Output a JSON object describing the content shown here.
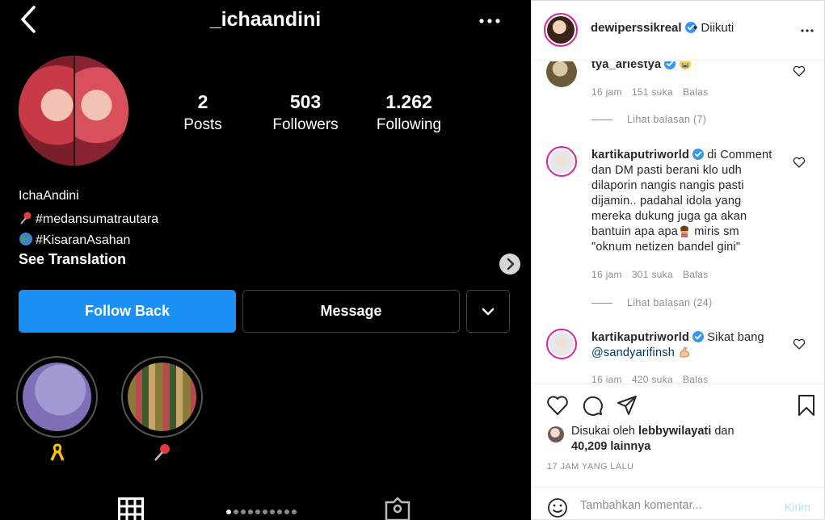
{
  "screenshot_profile": {
    "username": "_ichaandini",
    "stats": [
      {
        "value": "2",
        "label": "Posts"
      },
      {
        "value": "503",
        "label": "Followers"
      },
      {
        "value": "1.262",
        "label": "Following"
      }
    ],
    "bio_name": "IchaAndini",
    "bio_lines": [
      {
        "emoji": "pushpin-emoji",
        "text": "#medansumatrautara"
      },
      {
        "emoji": "globe-emoji",
        "text": "#KisaranAsahan"
      }
    ],
    "see_translation": "See Translation",
    "follow_back_label": "Follow Back",
    "message_label": "Message",
    "highlights": [
      {
        "emoji": "yellow-ribbon-emoji"
      },
      {
        "emoji": "pushpin-emoji"
      }
    ],
    "carousel_dots": 10,
    "carousel_active": 0,
    "colors": {
      "follow_button": "#1a8ff5",
      "background": "#000000"
    }
  },
  "post": {
    "header": {
      "username": "dewiperssikreal",
      "verified": true,
      "follow_status": "• Diikuti"
    },
    "comments": [
      {
        "username": "tya_ariestya",
        "verified": true,
        "text": "",
        "emoji": "crying-face-emoji",
        "meta": {
          "time": "16 jam",
          "likes": "151 suka",
          "reply": "Balas"
        },
        "view_replies": "Lihat balasan (7)"
      },
      {
        "username": "kartikaputriworld",
        "verified": true,
        "text": "di Comment dan DM pasti berani klo udh dilaporin nangis nangis pasti dijamin.. padahal idola yang mereka dukung juga ga akan bantuin apa apa",
        "text_after_emoji": " miris sm \"oknum netizen bandel gini\"",
        "emoji": "woman-facepalming-emoji",
        "meta": {
          "time": "16 jam",
          "likes": "301 suka",
          "reply": "Balas"
        },
        "view_replies": "Lihat balasan (24)"
      },
      {
        "username": "kartikaputriworld",
        "verified": true,
        "text": "Sikat bang",
        "mention": "@sandyarifinsh",
        "emoji": "flexed-biceps-emoji",
        "meta": {
          "time": "16 jam",
          "likes": "420 suka",
          "reply": "Balas"
        }
      }
    ],
    "likes": {
      "prefix": "Disukai oleh",
      "user": "lebbywilayati",
      "middle": "dan",
      "others": "40,209 lainnya"
    },
    "time_ago": "17 JAM YANG LALU",
    "comment_input": {
      "placeholder": "Tambahkan komentar...",
      "value": ""
    },
    "post_button": "Kirim",
    "colors": {
      "verified": "#3897f0",
      "post_button_disabled": "#b2dffc",
      "mention": "#00376b"
    }
  }
}
